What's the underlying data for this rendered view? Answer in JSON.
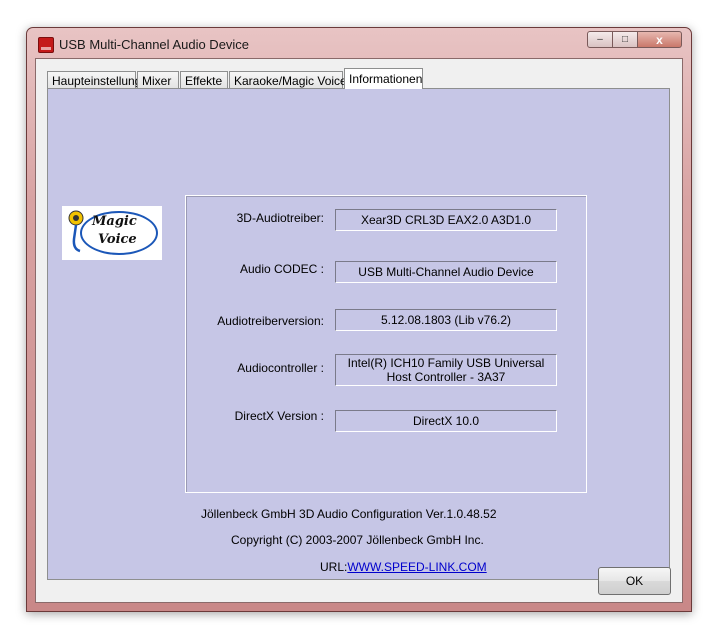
{
  "window": {
    "title": "USB Multi-Channel Audio Device"
  },
  "titlebar_buttons": {
    "minimize": "–",
    "maximize": "□",
    "close": "x"
  },
  "tabs": [
    {
      "label": "Haupteinstellung"
    },
    {
      "label": "Mixer"
    },
    {
      "label": "Effekte"
    },
    {
      "label": "Karaoke/Magic Voice"
    },
    {
      "label": "Informationen",
      "active": true
    }
  ],
  "logo": {
    "line1": "Magic",
    "line2": "Voice"
  },
  "info": {
    "rows": [
      {
        "label": "3D-Audiotreiber:",
        "value": "Xear3D  CRL3D  EAX2.0  A3D1.0"
      },
      {
        "label": "Audio CODEC :",
        "value": "USB Multi-Channel Audio Device"
      },
      {
        "label": "Audiotreiberversion:",
        "value": "5.12.08.1803 (Lib v76.2)"
      },
      {
        "label": "Audiocontroller :",
        "value": "Intel(R) ICH10 Family USB Universal Host Controller - 3A37"
      },
      {
        "label": "DirectX Version :",
        "value": "DirectX 10.0"
      }
    ]
  },
  "footer": {
    "config": "Jöllenbeck GmbH 3D Audio Configuration Ver.1.0.48.52",
    "copyright": "Copyright (C) 2003-2007 Jöllenbeck GmbH Inc.",
    "url_label": "URL:",
    "url": "WWW.SPEED-LINK.COM"
  },
  "buttons": {
    "ok": "OK"
  }
}
